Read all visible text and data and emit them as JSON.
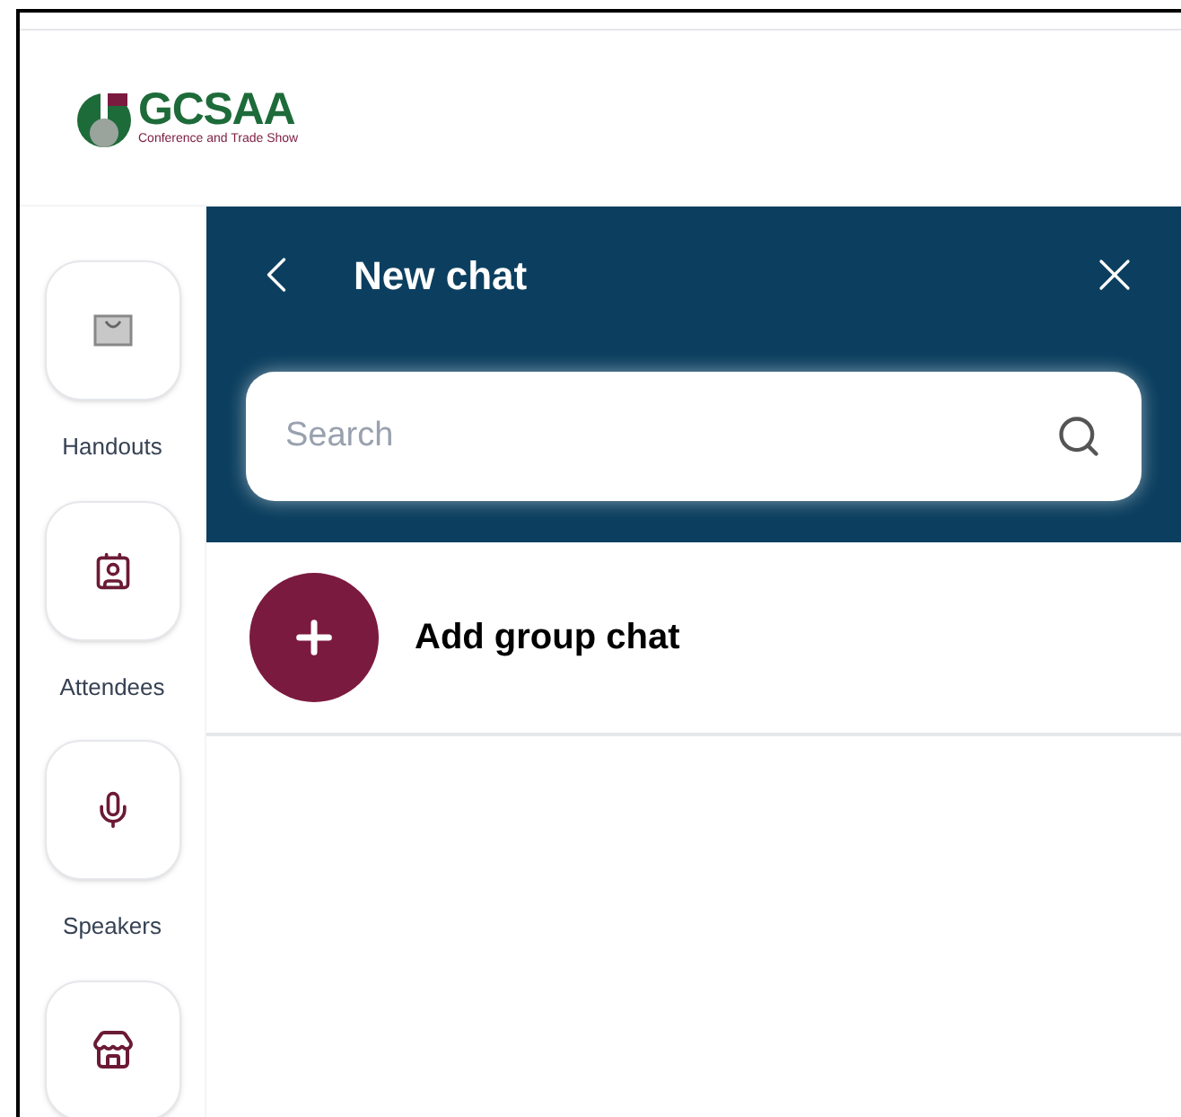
{
  "logo": {
    "name": "GCSAA",
    "tagline": "Conference and Trade Show"
  },
  "sidebar": {
    "items": [
      {
        "label": "Handouts",
        "kind": "bag"
      },
      {
        "label": "Attendees",
        "kind": "badge"
      },
      {
        "label": "Speakers",
        "kind": "mic"
      },
      {
        "kind": "store"
      }
    ]
  },
  "panel": {
    "title": "New chat",
    "search": {
      "placeholder": "Search"
    },
    "action": "Add group chat"
  }
}
